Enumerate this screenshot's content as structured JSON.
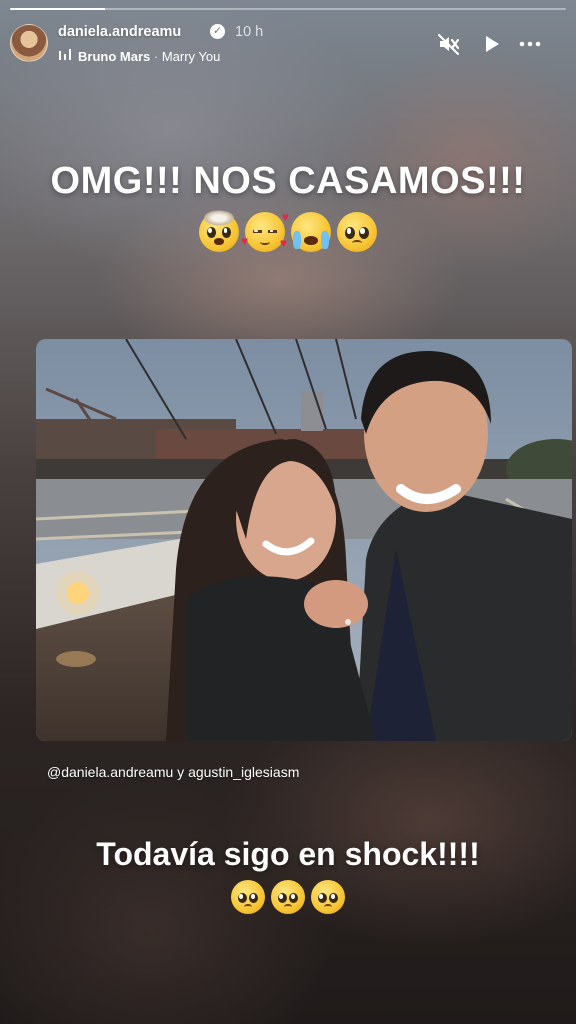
{
  "story": {
    "username": "daniela.andreamu",
    "time_ago": "10 h",
    "verified": true,
    "progress": 0.17,
    "music": {
      "artist": "Bruno Mars",
      "separator": "·",
      "title": "Marry You"
    }
  },
  "controls": {
    "mute_icon": "speaker-muted-icon",
    "play_icon": "play-icon",
    "more_icon": "more-options-icon"
  },
  "headline": "OMG!!! NOS CASAMOS!!!",
  "headline_emojis": [
    "exploding-head",
    "smiling-face-with-hearts",
    "loudly-crying-face",
    "pleading-face"
  ],
  "photo": {
    "description_icon": "engagement-selfie-photo"
  },
  "mentions": "@daniela.andreamu y agustin_iglesiasm",
  "caption": "Todavía sigo en shock!!!!",
  "caption_emojis": [
    "pleading-face",
    "pleading-face",
    "pleading-face"
  ],
  "colors": {
    "text": "#ffffff",
    "background_top": "#7d8690",
    "background_bottom": "#201b1a"
  }
}
